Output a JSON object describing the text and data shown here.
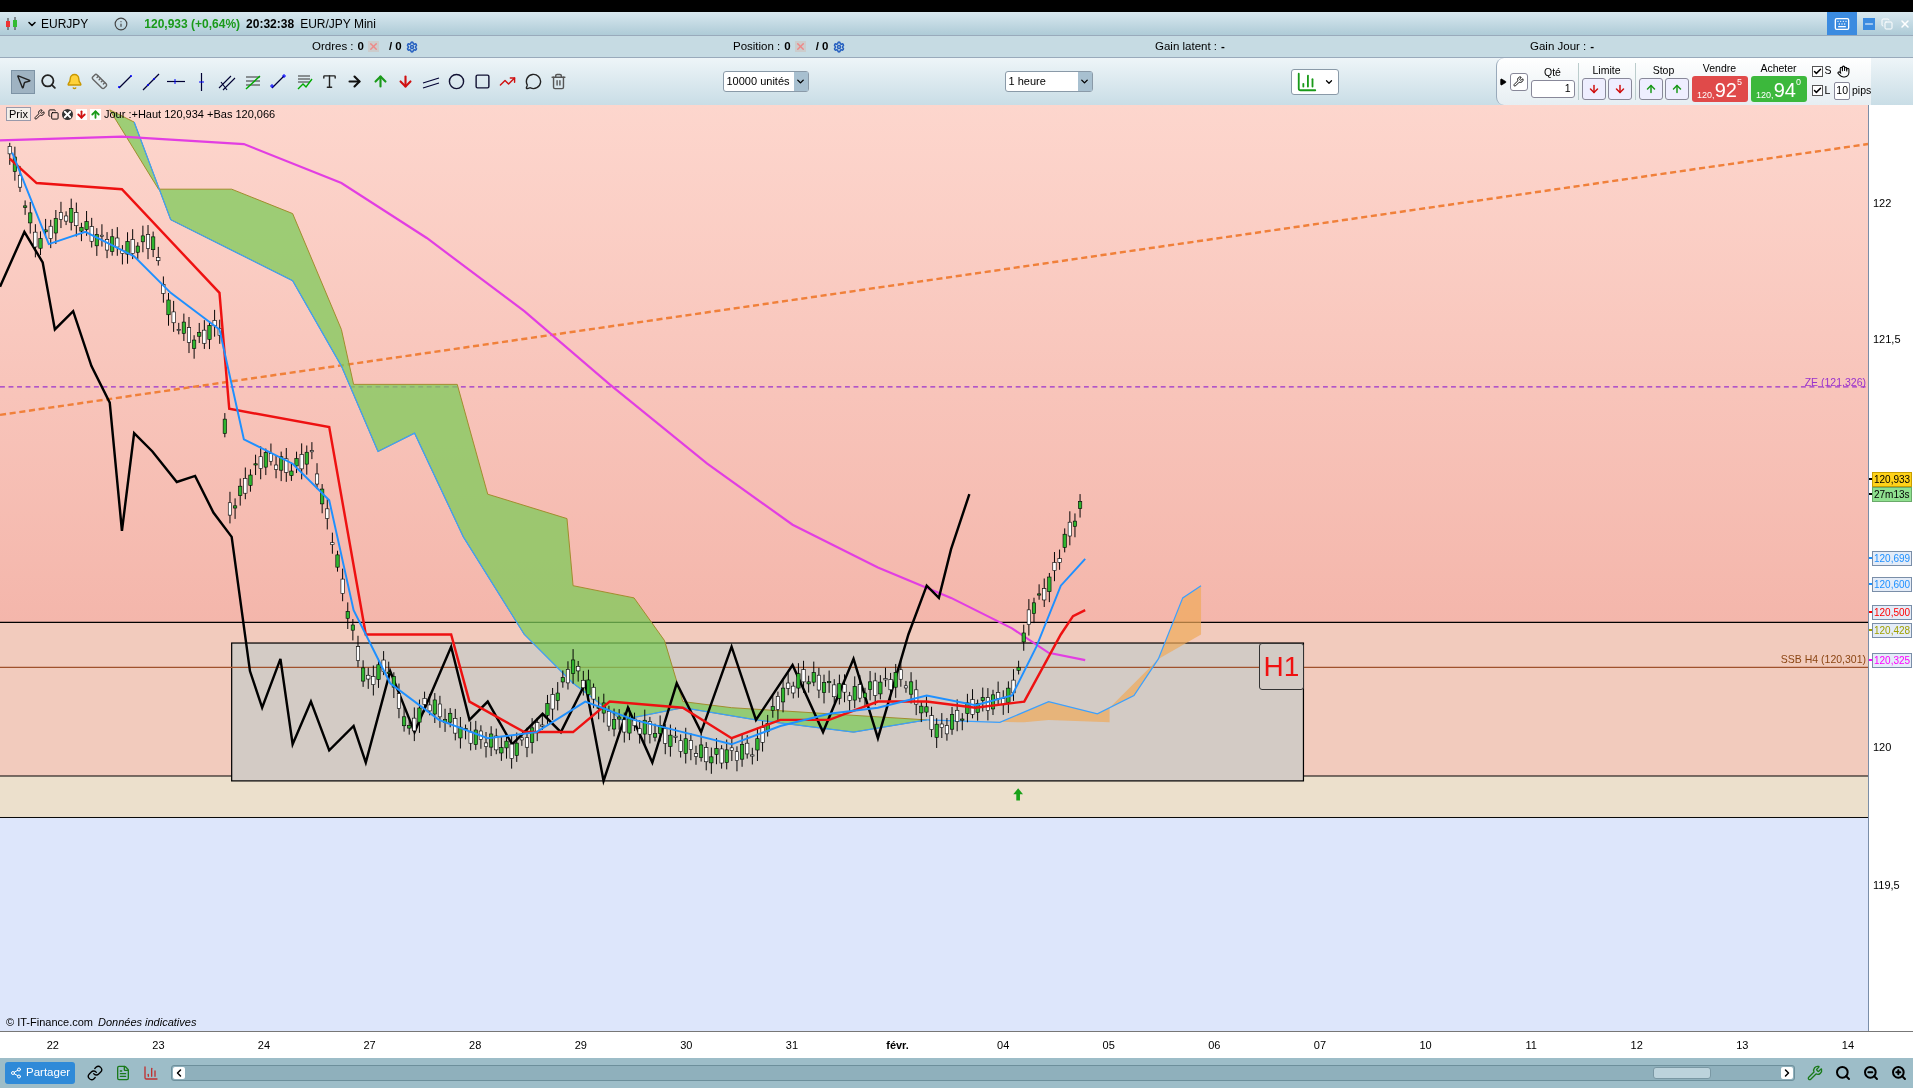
{
  "title_bar": {
    "symbol": "EURJPY",
    "quote": "120,933 (+0,64%)",
    "time": "20:32:38",
    "instrument": "EUR/JPY Mini"
  },
  "info_bar": [
    {
      "kind": "counter",
      "label": "Ordres :",
      "value": "0",
      "total": "/ 0"
    },
    {
      "kind": "counter",
      "label": "Position :",
      "value": "0",
      "total": "/ 0"
    },
    {
      "kind": "gain",
      "label": "Gain latent :",
      "value": "-"
    },
    {
      "kind": "gain",
      "label": "Gain Jour :",
      "value": "-"
    }
  ],
  "toolbar": {
    "tools": [
      {
        "kind": "pointer",
        "selected": true
      },
      {
        "kind": "zoom",
        "selected": false
      },
      {
        "kind": "alert",
        "selected": false
      },
      {
        "kind": "ruler",
        "selected": false
      },
      {
        "kind": "segment",
        "selected": false
      },
      {
        "kind": "line",
        "selected": false
      },
      {
        "kind": "hline",
        "selected": false
      },
      {
        "kind": "vline",
        "selected": false
      },
      {
        "kind": "channel",
        "selected": false
      },
      {
        "kind": "fibonacci",
        "selected": false
      },
      {
        "kind": "crossline",
        "selected": false
      },
      {
        "kind": "gann",
        "selected": false
      },
      {
        "kind": "text",
        "selected": false
      },
      {
        "kind": "arrow-right",
        "selected": false
      },
      {
        "kind": "arrow-up",
        "selected": false
      },
      {
        "kind": "arrow-down",
        "selected": false
      },
      {
        "kind": "parallel",
        "selected": false
      },
      {
        "kind": "ellipse",
        "selected": false
      },
      {
        "kind": "rectangle",
        "selected": false
      },
      {
        "kind": "trend",
        "selected": false
      },
      {
        "kind": "bubble",
        "selected": false
      },
      {
        "kind": "trash",
        "selected": false
      }
    ],
    "quantity_select": "10000 unités",
    "period_select": "1 heure"
  },
  "order_panel": {
    "qty_label": "Qté",
    "qty": "1",
    "limit_label": "Limite",
    "stop_label": "Stop",
    "sell": {
      "label": "Vendre",
      "prefix": "120,",
      "big": "92",
      "sup": "5"
    },
    "buy": {
      "label": "Acheter",
      "prefix": "120,",
      "big": "94",
      "sup": "0"
    },
    "options": [
      {
        "label": "S",
        "checked": true
      },
      {
        "label": "L",
        "checked": true
      }
    ],
    "pips": "10",
    "pips_label": "pips"
  },
  "chart": {
    "legend": "Prix",
    "header": "Jour :+Haut 120,934 +Bas 120,066",
    "price_axis": [
      "122",
      "121,5",
      "120",
      "119,5"
    ],
    "price_tags": [
      {
        "kind": "last",
        "text": "120,933",
        "color": "#000000"
      },
      {
        "kind": "timer",
        "text": "27m13s",
        "color": "#000000"
      },
      {
        "kind": "level",
        "text": "120,699",
        "color": "#1e90ff"
      },
      {
        "kind": "level",
        "text": "120,600",
        "color": "#1e90ff"
      },
      {
        "kind": "level",
        "text": "120,500",
        "color": "#ff0000"
      },
      {
        "kind": "level",
        "text": "120,428",
        "color": "#a0a000"
      },
      {
        "kind": "level",
        "text": "120,325",
        "color": "#ff00ff"
      }
    ],
    "line_labels": [
      {
        "text": "ZE (121,326)",
        "color": "#9932cc"
      },
      {
        "text": "SSB H4 (120,301)",
        "color": "#8b4513"
      }
    ],
    "box_label": "H1",
    "copyright": "© IT-Finance.com",
    "disclaimer": "Données indicatives",
    "time_axis": [
      {
        "label": "22",
        "bold": false
      },
      {
        "label": "23",
        "bold": false
      },
      {
        "label": "24",
        "bold": false
      },
      {
        "label": "27",
        "bold": false
      },
      {
        "label": "28",
        "bold": false
      },
      {
        "label": "29",
        "bold": false
      },
      {
        "label": "30",
        "bold": false
      },
      {
        "label": "31",
        "bold": false
      },
      {
        "label": "févr.",
        "bold": true
      },
      {
        "label": "04",
        "bold": false
      },
      {
        "label": "05",
        "bold": false
      },
      {
        "label": "06",
        "bold": false
      },
      {
        "label": "07",
        "bold": false
      },
      {
        "label": "10",
        "bold": false
      },
      {
        "label": "11",
        "bold": false
      },
      {
        "label": "12",
        "bold": false
      },
      {
        "label": "13",
        "bold": false
      },
      {
        "label": "14",
        "bold": false
      }
    ]
  },
  "bottom_bar": {
    "share": "Partager"
  }
}
